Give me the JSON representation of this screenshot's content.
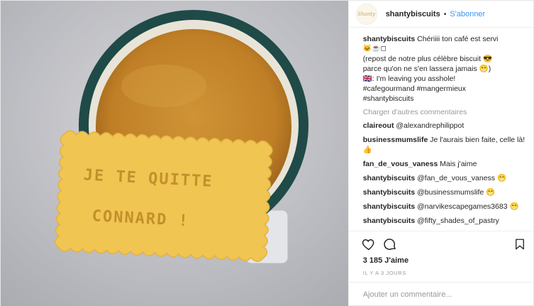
{
  "header": {
    "avatar_text": "Shanty",
    "username": "shantybiscuits",
    "separator": "•",
    "follow_label": "S'abonner"
  },
  "caption": {
    "username": "shantybiscuits",
    "line1": "Chériiii ton café est servi",
    "line2": "🐱☕◻",
    "line3": "(repost de notre plus célèbre biscuit 😎",
    "line4": "parce qu'on ne s'en lassera jamais 😁)",
    "line5": "🇬🇧: I'm leaving you asshole!",
    "line6": "#cafegourmand #mangermieux",
    "line7": "#shantybiscuits"
  },
  "load_more": "Charger d'autres commentaires",
  "comments": [
    {
      "user": "claireout",
      "text": "@alexandrephilippot"
    },
    {
      "user": "businessmumslife",
      "text": "Je l'aurais bien faite, celle là! 👍"
    },
    {
      "user": "fan_de_vous_vaness",
      "text": "Mais j'aime"
    },
    {
      "user": "shantybiscuits",
      "text": "@fan_de_vous_vaness 😁"
    },
    {
      "user": "shantybiscuits",
      "text": "@businessmumslife 😁"
    },
    {
      "user": "shantybiscuits",
      "text": "@narvikescapegames3683 😁"
    },
    {
      "user": "shantybiscuits",
      "text": "@fifty_shades_of_pastry"
    }
  ],
  "likes": "3 185 J'aime",
  "time_ago": "IL Y A 3 JOURS",
  "add_comment_placeholder": "Ajouter un commentaire...",
  "biscuit": {
    "line1": "JE TE QUITTE",
    "line2": "CONNARD !"
  },
  "icons": [
    "heart-icon",
    "comment-icon",
    "bookmark-icon"
  ],
  "colors": {
    "mug_rim": "#1f4a48",
    "coffee": "#c78a2e",
    "biscuit": "#f0c552",
    "link_blue": "#3897f0"
  }
}
